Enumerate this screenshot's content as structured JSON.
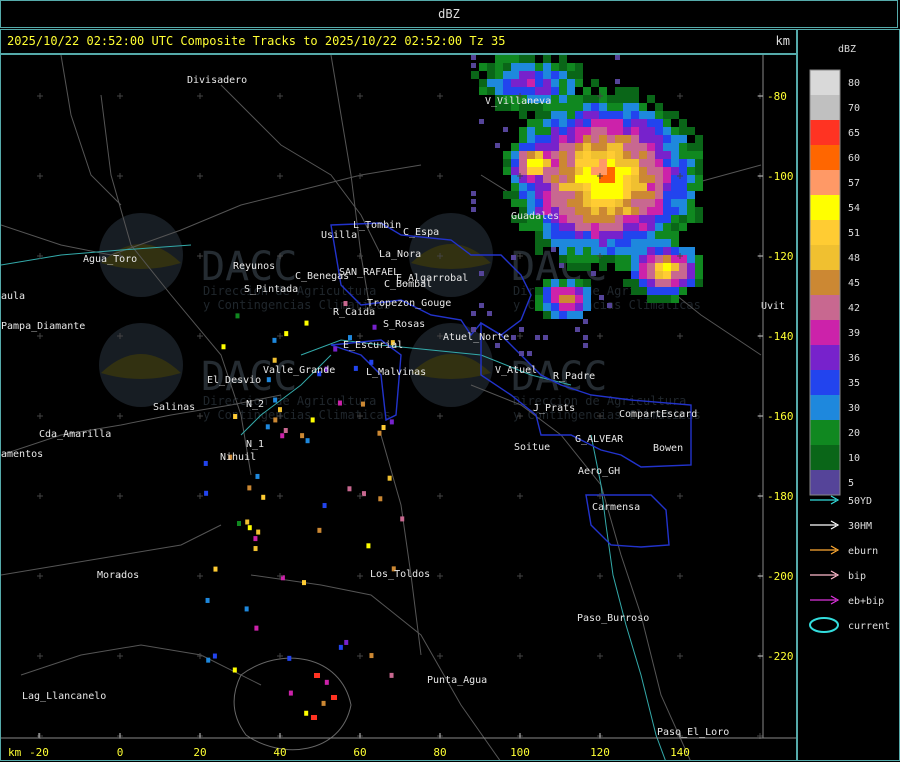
{
  "window_title": "dBZ",
  "header": {
    "run_text": "2025/10/22 02:52:00 UTC Composite Tracks to 2025/10/22 02:52:00 Tz 35",
    "unit": "km"
  },
  "legend": {
    "unit": "dBZ",
    "scale": [
      {
        "value": "80",
        "color": "#d9d9d9"
      },
      {
        "value": "70",
        "color": "#c0c0c0"
      },
      {
        "value": "65",
        "color": "#ff3322"
      },
      {
        "value": "60",
        "color": "#ff6600"
      },
      {
        "value": "57",
        "color": "#ff9966"
      },
      {
        "value": "54",
        "color": "#ffff00"
      },
      {
        "value": "51",
        "color": "#ffcc33"
      },
      {
        "value": "48",
        "color": "#f0c030"
      },
      {
        "value": "45",
        "color": "#cc8833"
      },
      {
        "value": "42",
        "color": "#c86890"
      },
      {
        "value": "39",
        "color": "#cc22aa"
      },
      {
        "value": "36",
        "color": "#7722cc"
      },
      {
        "value": "35",
        "color": "#2244ee"
      },
      {
        "value": "30",
        "color": "#1e88dd"
      },
      {
        "value": "20",
        "color": "#108820"
      },
      {
        "value": "10",
        "color": "#0a6618"
      },
      {
        "value": "5",
        "color": "#554499"
      }
    ],
    "tracks": [
      {
        "label": "50YD",
        "color": "#33dddd"
      },
      {
        "label": "30HM",
        "color": "#ffffff"
      },
      {
        "label": "eburn",
        "color": "#ffaa33"
      },
      {
        "label": "bip",
        "color": "#ffbbcc"
      },
      {
        "label": "eb+bip",
        "color": "#dd33dd"
      },
      {
        "label": "current",
        "color": "#33dddd"
      }
    ]
  },
  "axes": {
    "x_ticks": [
      "-20",
      "0",
      "20",
      "40",
      "60",
      "80",
      "100",
      "120",
      "140"
    ],
    "x_unit": "km",
    "y_ticks": [
      "-80",
      "-100",
      "-120",
      "-140",
      "-160",
      "-180",
      "-200",
      "-220"
    ]
  },
  "places": [
    {
      "name": "Divisadero"
    },
    {
      "name": "V_Villaneva"
    },
    {
      "name": "Usilla"
    },
    {
      "name": "L_Tombin"
    },
    {
      "name": "C_Espa"
    },
    {
      "name": "La_Nora"
    },
    {
      "name": "C_Benegas"
    },
    {
      "name": "SAN_RAFAEL"
    },
    {
      "name": "E_Algarrobal"
    },
    {
      "name": "C_Bombal"
    },
    {
      "name": "Reyunos"
    },
    {
      "name": "S_Pintada"
    },
    {
      "name": "Agua_Toro"
    },
    {
      "name": "Pampa_Diamante"
    },
    {
      "name": "Cda_Amarilla"
    },
    {
      "name": "Salinas"
    },
    {
      "name": "El_Desvio"
    },
    {
      "name": "Valle_Grande"
    },
    {
      "name": "R_Caida"
    },
    {
      "name": "S_Rosas"
    },
    {
      "name": "E_Escurial"
    },
    {
      "name": "L_Malvinas"
    },
    {
      "name": "Atuel_Norte"
    },
    {
      "name": "V_Atuel"
    },
    {
      "name": "R_Padre"
    },
    {
      "name": "J_Prats"
    },
    {
      "name": "CompartEscard"
    },
    {
      "name": "G_ALVEAR"
    },
    {
      "name": "Soitue"
    },
    {
      "name": "Bowen"
    },
    {
      "name": "Aero_GH"
    },
    {
      "name": "Carmensa"
    },
    {
      "name": "Guadales"
    },
    {
      "name": "Nihuil"
    },
    {
      "name": "N_1"
    },
    {
      "name": "N_2"
    },
    {
      "name": "Los_Toldos"
    },
    {
      "name": "Morados"
    },
    {
      "name": "Paso_Burroso"
    },
    {
      "name": "Punta_Agua"
    },
    {
      "name": "Lag_Llancanelo"
    },
    {
      "name": "Paso_El_Loro"
    },
    {
      "name": "Tropezon_Gouge"
    },
    {
      "name": "Uvit"
    },
    {
      "name": "aula"
    },
    {
      "name": "amentos"
    }
  ],
  "watermark": {
    "logo": "DACC",
    "text1": "Direccion de Agricultura",
    "text2": "y Contingencias Climaticas"
  }
}
